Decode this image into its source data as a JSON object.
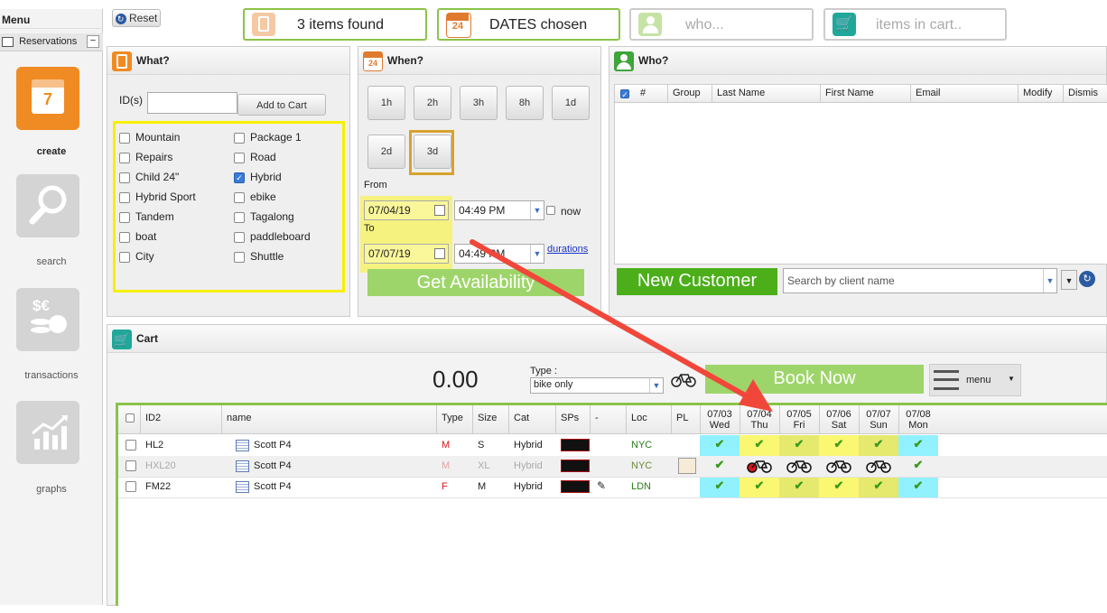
{
  "sidebar": {
    "menu_title": "Menu",
    "reservations_label": "Reservations",
    "collapse_glyph": "−",
    "nav": [
      {
        "label": "create",
        "icon": "calendar-icon",
        "number": "7"
      },
      {
        "label": "search",
        "icon": "magnifier-icon"
      },
      {
        "label": "transactions",
        "icon": "coins-icon",
        "symbols": "$€"
      },
      {
        "label": "graphs",
        "icon": "chart-icon"
      }
    ]
  },
  "topbar": {
    "reset_label": "Reset",
    "items_found": "3 items found",
    "dates_chosen": "DATES chosen",
    "who": "who...",
    "cart": "items in cart..",
    "calendar_day": "24"
  },
  "what": {
    "title": "What?",
    "ids_label": "ID(s)",
    "ids_value": "",
    "add_to_cart": "Add to Cart",
    "categories_left": [
      {
        "label": "Mountain",
        "checked": false
      },
      {
        "label": "Repairs",
        "checked": false
      },
      {
        "label": "Child 24\"",
        "checked": false
      },
      {
        "label": "Hybrid Sport",
        "checked": false
      },
      {
        "label": "Tandem",
        "checked": false
      },
      {
        "label": "boat",
        "checked": false
      },
      {
        "label": "City",
        "checked": false
      }
    ],
    "categories_right": [
      {
        "label": "Package 1",
        "checked": false
      },
      {
        "label": "Road",
        "checked": false
      },
      {
        "label": "Hybrid",
        "checked": true
      },
      {
        "label": "ebike",
        "checked": false
      },
      {
        "label": "Tagalong",
        "checked": false
      },
      {
        "label": "paddleboard",
        "checked": false
      },
      {
        "label": "Shuttle",
        "checked": false
      }
    ]
  },
  "when": {
    "title": "When?",
    "durations_row1": [
      "1h",
      "2h",
      "3h",
      "8h",
      "1d"
    ],
    "durations_row2": [
      "2d",
      "3d"
    ],
    "selected_duration": "3d",
    "from_label": "From",
    "from_date": "07/04/19",
    "from_time": "04:49 PM",
    "now_label": "now",
    "to_label": "To",
    "to_date": "07/07/19",
    "to_time": "04:49 PM",
    "durations_link": "durations",
    "get_availability": "Get Availability"
  },
  "who": {
    "title": "Who?",
    "columns": [
      "#",
      "Group",
      "Last Name",
      "First Name",
      "Email",
      "Modify",
      "Dismis"
    ],
    "new_customer": "New Customer",
    "search_placeholder": "Search by client name"
  },
  "cart": {
    "title": "Cart",
    "total": "0.00",
    "type_label": "Type :",
    "type_value": "bike only",
    "book_now": "Book Now",
    "menu_label": "menu"
  },
  "grid": {
    "columns": [
      "ID2",
      "name",
      "Type",
      "Size",
      "Cat",
      "SPs",
      "-",
      "Loc",
      "PL"
    ],
    "dates": [
      {
        "date": "07/03",
        "day": "Wed"
      },
      {
        "date": "07/04",
        "day": "Thu"
      },
      {
        "date": "07/05",
        "day": "Fri"
      },
      {
        "date": "07/06",
        "day": "Sat"
      },
      {
        "date": "07/07",
        "day": "Sun"
      },
      {
        "date": "07/08",
        "day": "Mon"
      }
    ],
    "rows": [
      {
        "id": "HL2",
        "name": "Scott P4",
        "type": "M",
        "size": "S",
        "cat": "Hybrid",
        "loc": "NYC",
        "dim": false,
        "cells": [
          "check",
          "check",
          "check",
          "check",
          "check",
          "check"
        ]
      },
      {
        "id": "HXL20",
        "name": "Scott P4",
        "type": "M",
        "size": "XL",
        "cat": "Hybrid",
        "loc": "NYC",
        "dim": true,
        "cells": [
          "check",
          "bike-red",
          "bike",
          "bike",
          "bike",
          "check"
        ]
      },
      {
        "id": "FM22",
        "name": "Scott P4",
        "type": "F",
        "size": "M",
        "cat": "Hybrid",
        "loc": "LDN",
        "dim": false,
        "cells": [
          "check",
          "check",
          "check",
          "check",
          "check",
          "check"
        ]
      }
    ]
  },
  "colors": {
    "accent_green": "#8bc34a",
    "highlight_yellow": "#f6f000",
    "highlight_cyan": "#7fefff",
    "arrow_red": "#f0473a",
    "selected_border": "#d8a22f"
  }
}
